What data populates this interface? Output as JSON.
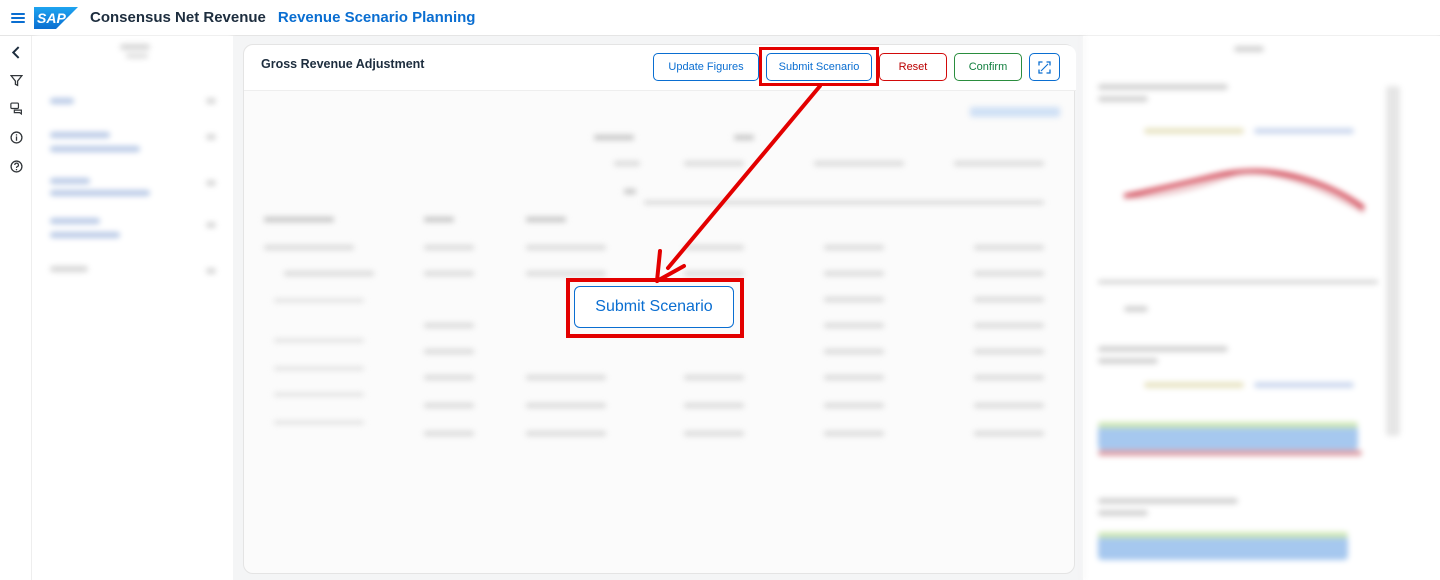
{
  "shellbar": {
    "logo_text": "SAP",
    "app_title": "Consensus Net Revenue",
    "app_subtitle": "Revenue Scenario Planning"
  },
  "card": {
    "title": "Gross Revenue Adjustment",
    "buttons": {
      "update": "Update Figures",
      "submit": "Submit Scenario",
      "reset": "Reset",
      "confirm": "Confirm"
    }
  },
  "callout": {
    "label": "Submit Scenario"
  },
  "icons": {
    "menu": "hamburger-menu-icon",
    "back": "chevron-left-icon",
    "filter": "filter-icon",
    "comments": "comments-icon",
    "info": "info-icon",
    "help": "help-icon",
    "fullscreen": "fullscreen-icon"
  },
  "colors": {
    "brand_blue": "#0a6ed1",
    "reset_red": "#bb0000",
    "confirm_green": "#107e3e",
    "highlight_red": "#e30000"
  }
}
